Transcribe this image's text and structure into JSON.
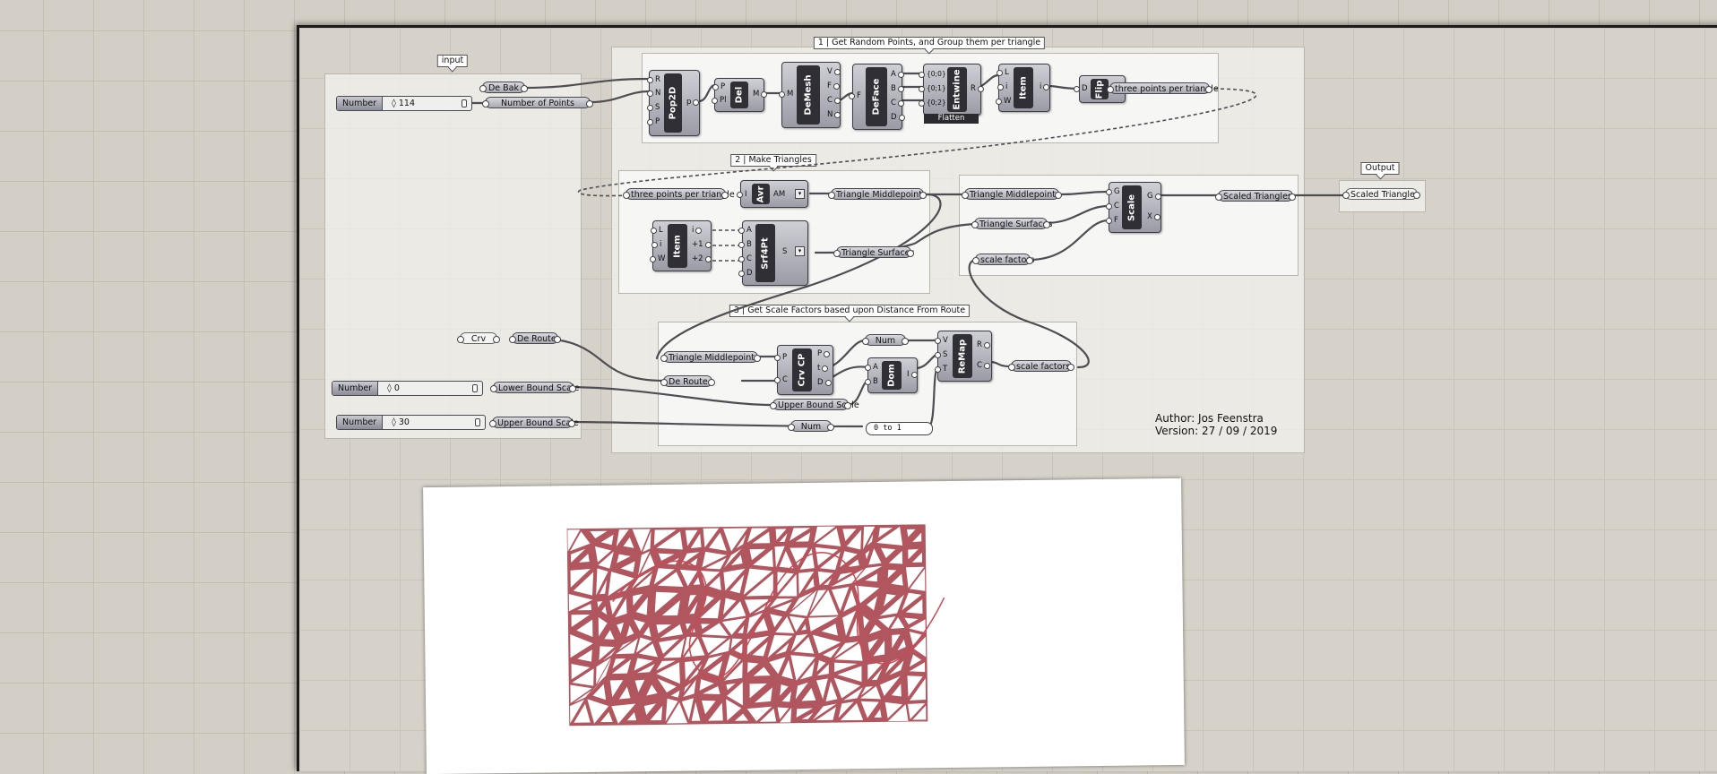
{
  "groups": {
    "input": "input",
    "output": "Output",
    "g1": "1 | Get Random Points, and Group them per triangle",
    "g2": "2 | Make Triangles",
    "g3": "3 | Get Scale Factors based upon Distance From Route"
  },
  "sliders": {
    "points": {
      "label": "Number",
      "value": "◊ 114"
    },
    "lower": {
      "label": "Number",
      "value": "◊ 0"
    },
    "upper": {
      "label": "Number",
      "value": "◊ 30"
    }
  },
  "params": {
    "de_bak": "De Bak",
    "num_points": "Number of Points",
    "crv": "Crv",
    "de_route_in": "De Route",
    "lower_bound": "Lower Bound Scale",
    "upper_bound": "Upper Bound Scale",
    "three_points_out": "three points per triangle",
    "three_points_in": "three points per triangle",
    "tri_mid_1": "Triangle Middlepoints",
    "tri_surf_1": "Triangle Surfaces",
    "tri_mid_2": "Triangle Middlepoints",
    "tri_surf_2": "Triangle Surfaces",
    "scale_factors_in": "scale factors",
    "scaled_tri": "Scaled Triangles",
    "scaled_tri_out": "Scaled Triangles",
    "tri_mid_3": "Triangle Middlepoints",
    "de_route_3": "De Route",
    "upper_bound_3": "Upper Bound Scale",
    "num_a": "Num",
    "num_b": "Num",
    "scale_factors_out": "scale factors",
    "zero_to_one": "0 to 1"
  },
  "components": {
    "pop2d": {
      "name": "Pop2D",
      "inputs": [
        "R",
        "N",
        "S",
        "P"
      ],
      "outputs": [
        "p"
      ]
    },
    "del": {
      "name": "Del",
      "inputs": [
        "P",
        "Pl"
      ],
      "outputs": [
        "M"
      ]
    },
    "demesh": {
      "name": "DeMesh",
      "inputs": [
        "M"
      ],
      "outputs": [
        "V",
        "F",
        "C",
        "N"
      ]
    },
    "deface": {
      "name": "DeFace",
      "inputs": [
        "F"
      ],
      "outputs": [
        "A",
        "B",
        "C",
        "D"
      ]
    },
    "entwine": {
      "name": "Entwine",
      "inputs": [
        "{0;0}",
        "{0;1}",
        "{0;2}"
      ],
      "outputs": [
        "R"
      ],
      "footer": "Flatten"
    },
    "item1": {
      "name": "Item",
      "inputs": [
        "L",
        "i",
        "W"
      ],
      "outputs": [
        "i"
      ]
    },
    "flip": {
      "name": "Flip",
      "inputs": [
        "D"
      ],
      "outputs": []
    },
    "avr": {
      "name": "Avr",
      "inputs": [
        "I"
      ],
      "outputs": [
        "AM"
      ]
    },
    "item2": {
      "name": "Item",
      "inputs": [
        "L",
        "i",
        "W"
      ],
      "outputs": [
        "i",
        "+1",
        "+2"
      ]
    },
    "srf4pt": {
      "name": "Srf4Pt",
      "inputs": [
        "A",
        "B",
        "C",
        "D"
      ],
      "outputs": [
        "S"
      ]
    },
    "scale": {
      "name": "Scale",
      "inputs": [
        "G",
        "C",
        "F"
      ],
      "outputs": [
        "G",
        "X"
      ]
    },
    "crvcp": {
      "name": "Crv CP",
      "inputs": [
        "P",
        "C"
      ],
      "outputs": [
        "P",
        "t",
        "D"
      ]
    },
    "dom": {
      "name": "Dom",
      "inputs": [
        "A",
        "B"
      ],
      "outputs": [
        "I"
      ]
    },
    "remap": {
      "name": "ReMap",
      "inputs": [
        "V",
        "S",
        "T"
      ],
      "outputs": [
        "R",
        "C"
      ]
    }
  },
  "author": {
    "line1": "Author: Jos Feenstra",
    "line2": "Version: 27 / 09 / 2019"
  },
  "colors": {
    "canvas": "#d3cfc6",
    "component": "#2f2f35",
    "triangles": "#a8434d",
    "route": "#c94a55"
  }
}
